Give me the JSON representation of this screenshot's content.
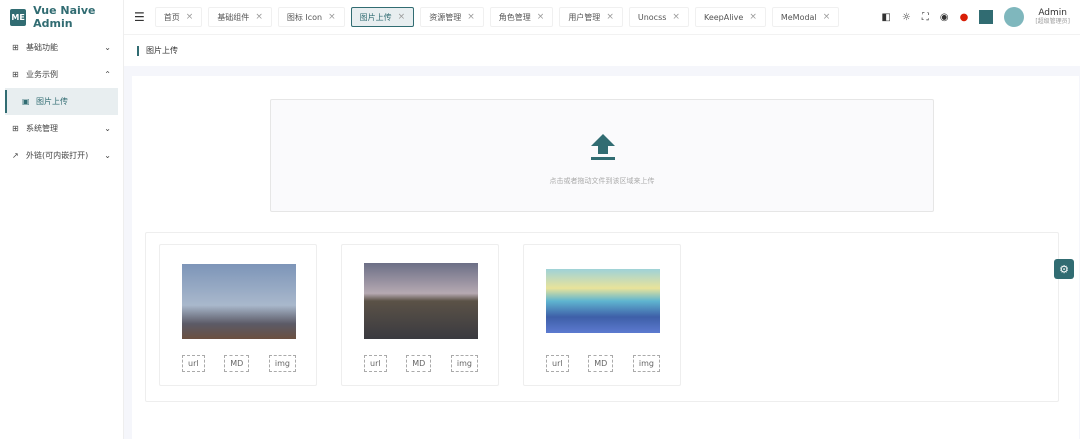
{
  "app": {
    "logo": "ME",
    "title": "Vue Naive Admin"
  },
  "sidebar": {
    "items": [
      {
        "label": "基础功能",
        "icon": "grid-icon",
        "expanded": false
      },
      {
        "label": "业务示例",
        "icon": "grid-icon",
        "expanded": true
      },
      {
        "label": "图片上传",
        "icon": "image-icon",
        "active": true
      },
      {
        "label": "系统管理",
        "icon": "grid-icon",
        "expanded": false
      },
      {
        "label": "外链(可内嵌打开)",
        "icon": "external-link-icon",
        "expanded": false
      }
    ]
  },
  "tabs": [
    {
      "label": "首页"
    },
    {
      "label": "基础组件"
    },
    {
      "label": "图标 Icon"
    },
    {
      "label": "图片上传",
      "active": true
    },
    {
      "label": "资源管理"
    },
    {
      "label": "角色管理"
    },
    {
      "label": "用户管理"
    },
    {
      "label": "Unocss"
    },
    {
      "label": "KeepAlive"
    },
    {
      "label": "MeModal"
    }
  ],
  "user": {
    "name": "Admin",
    "role": "[超级管理员]"
  },
  "breadcrumb": "图片上传",
  "upload": {
    "hint": "点击或者拖动文件到该区域来上传"
  },
  "images": [
    {
      "buttons": [
        "url",
        "MD",
        "img"
      ]
    },
    {
      "buttons": [
        "url",
        "MD",
        "img"
      ]
    },
    {
      "buttons": [
        "url",
        "MD",
        "img"
      ]
    }
  ],
  "colors": {
    "primary": "#316c72"
  }
}
